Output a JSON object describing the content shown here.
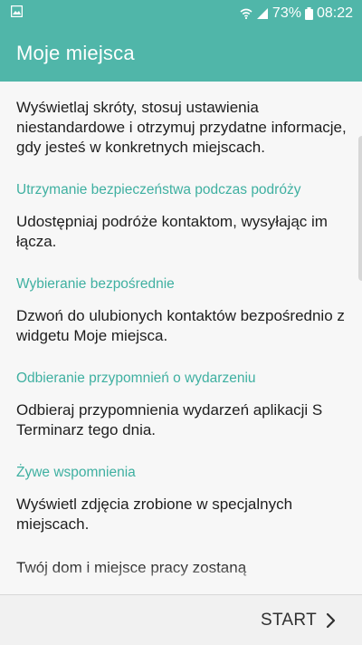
{
  "status_bar": {
    "battery_percent": "73%",
    "time": "08:22",
    "icons": [
      "gallery-icon",
      "wifi-icon",
      "signal-icon",
      "battery-icon"
    ]
  },
  "app_bar": {
    "title": "Moje miejsca"
  },
  "content": {
    "intro": "Wyświetlaj skróty, stosuj ustawienia niestandardowe i otrzymuj przydatne informacje, gdy jesteś w konkretnych miejscach.",
    "sections": [
      {
        "heading": "Utrzymanie bezpieczeństwa podczas podróży",
        "text": "Udostępniaj podróże kontaktom, wysyłając im łącza."
      },
      {
        "heading": "Wybieranie bezpośrednie",
        "text": "Dzwoń do ulubionych kontaktów bezpośrednio z widgetu Moje miejsca."
      },
      {
        "heading": "Odbieranie przypomnień o wydarzeniu",
        "text": "Odbieraj przypomnienia wydarzeń aplikacji S Terminarz tego dnia."
      },
      {
        "heading": "Żywe wspomnienia",
        "text": "Wyświetl zdjęcia zrobione w specjalnych miejscach."
      }
    ],
    "footer_text": "Twój dom i miejsce pracy zostaną"
  },
  "bottom_bar": {
    "start_label": "START"
  },
  "colors": {
    "accent": "#50b6a9",
    "heading": "#3fb0a1",
    "text": "#1e1e1e",
    "background": "#f7f7f7"
  }
}
